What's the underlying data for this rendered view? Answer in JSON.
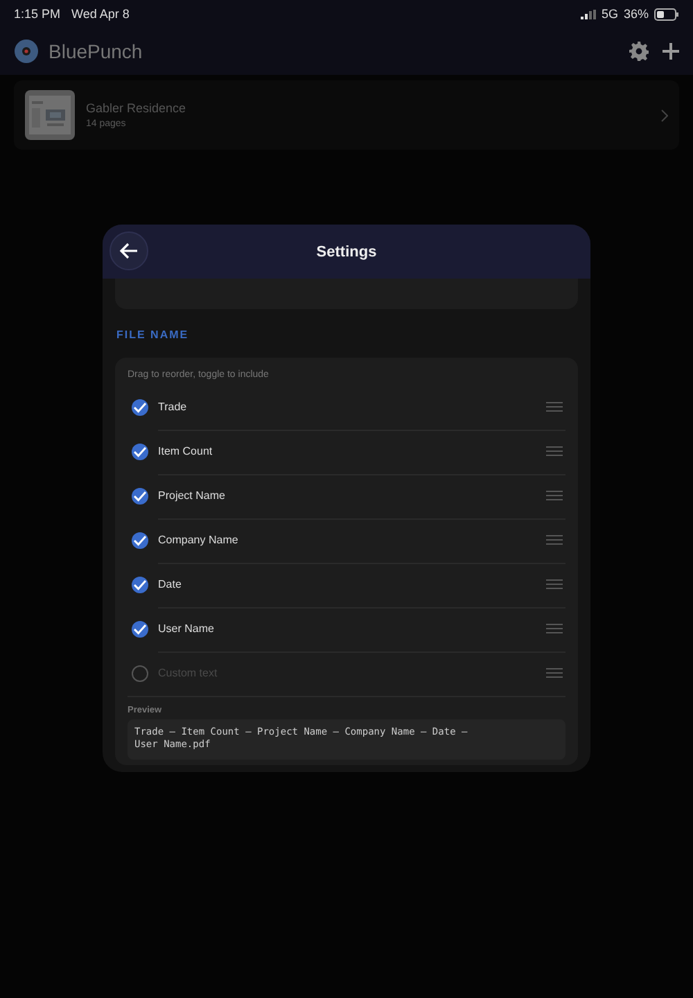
{
  "status_bar": {
    "time": "1:15 PM",
    "date": "Wed Apr 8",
    "network": "5G",
    "battery": "36%"
  },
  "app_bar": {
    "title": "BluePunch"
  },
  "projects": [
    {
      "name": "Gabler Residence",
      "pages": "14 pages"
    }
  ],
  "settings": {
    "title": "Settings",
    "section": "FILE NAME",
    "hint": "Drag to reorder, toggle to include",
    "fields": [
      {
        "kind": "item",
        "label": "Trade",
        "checked": true
      },
      {
        "kind": "item",
        "label": "Item Count",
        "checked": true
      },
      {
        "kind": "item",
        "label": "Project Name",
        "checked": true
      },
      {
        "kind": "item",
        "label": "Company Name",
        "checked": true
      },
      {
        "kind": "item",
        "label": "Date",
        "checked": true
      },
      {
        "kind": "item",
        "label": "User Name",
        "checked": true
      },
      {
        "kind": "custom",
        "placeholder": "Custom text",
        "checked": false
      }
    ],
    "preview_label": "Preview",
    "preview": "Trade – Item Count – Project Name – Company Name – Date – User Name.pdf"
  }
}
